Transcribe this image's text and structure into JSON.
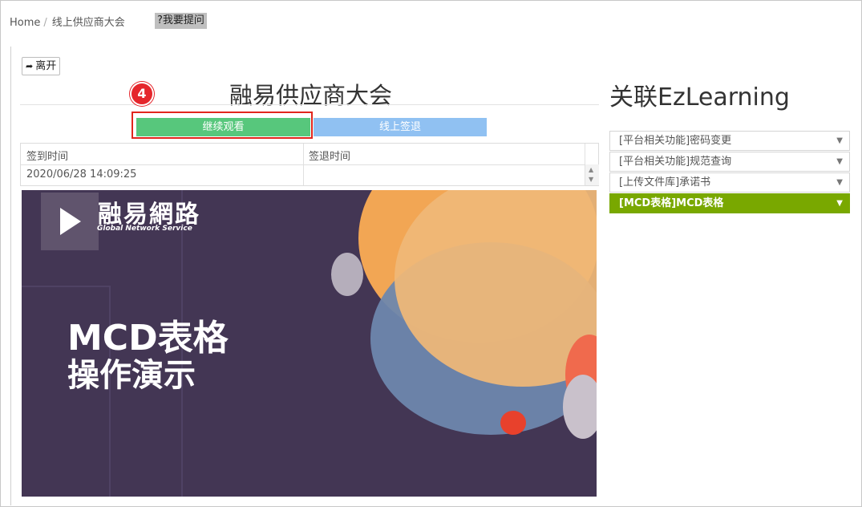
{
  "breadcrumb": {
    "home": "Home",
    "separator": "/",
    "current": "线上供应商大会"
  },
  "header": {
    "ask_label": "?我要提问"
  },
  "panel": {
    "leave_label": "离开",
    "title": "融易供应商大会",
    "step_number": "4",
    "continue_label": "继续观看",
    "signout_label": "线上签退"
  },
  "table": {
    "columns": [
      "签到时间",
      "签退时间"
    ],
    "rows": [
      [
        "2020/06/28 14:09:25",
        ""
      ]
    ]
  },
  "video": {
    "brand_cn": "融易網路",
    "brand_en": "Global Network Service",
    "slide_line1": "MCD表格",
    "slide_line2": "操作演示",
    "icon": "play-icon"
  },
  "sidebar": {
    "title": "关联EzLearning",
    "items": [
      {
        "label": "[平台相关功能]密码变更"
      },
      {
        "label": "[平台相关功能]规范查询"
      },
      {
        "label": "[上传文件库]承诺书"
      },
      {
        "label": "[MCD表格]MCD表格"
      }
    ],
    "active_color": "#79a800"
  },
  "colors": {
    "continue": "#57c77c",
    "signout": "#90c1f2",
    "highlight": "#e1261d",
    "video_bg": "#433654"
  }
}
